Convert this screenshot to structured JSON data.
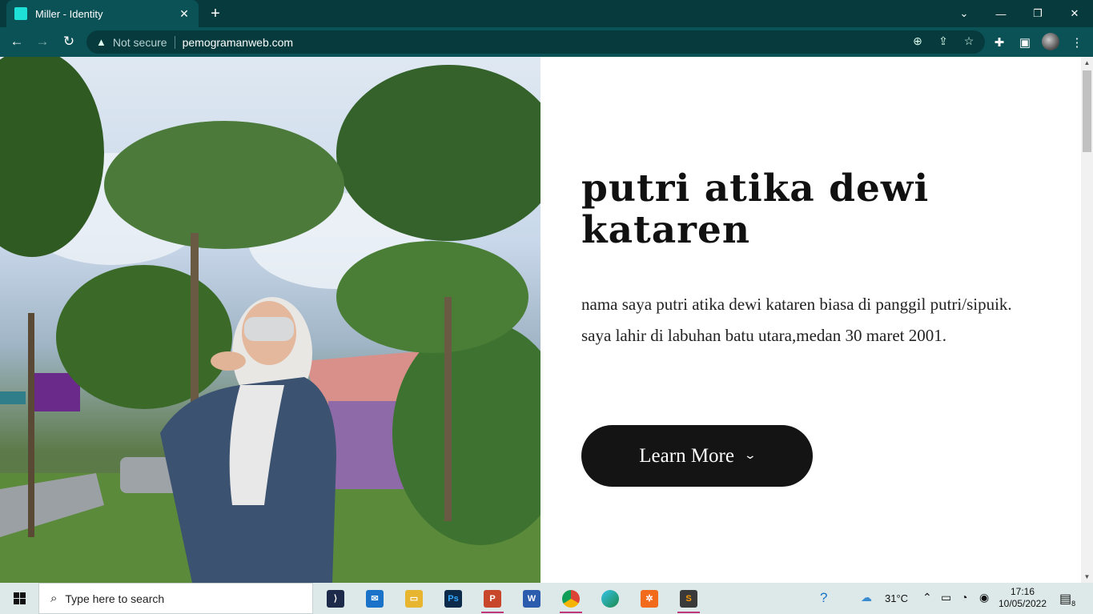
{
  "browser": {
    "tab_title": "Miller - Identity",
    "tab_close": "✕",
    "new_tab": "+",
    "security_label": "Not secure",
    "url": "pemogramanweb.com"
  },
  "page": {
    "name": "putri atika dewi kataren",
    "bio": "nama saya putri atika dewi kataren biasa di panggil putri/sipuik. saya lahir di labuhan batu utara,medan 30 maret 2001.",
    "button_label": "Learn More"
  },
  "taskbar": {
    "search_placeholder": "Type here to search",
    "weather": "31°C",
    "time": "17:16",
    "date": "10/05/2022",
    "notification_count": "8"
  },
  "colors": {
    "chrome_dark": "#063a3d",
    "chrome_toolbar": "#0b5257",
    "button_bg": "#141414",
    "taskbar_bg": "#dde9e8"
  }
}
